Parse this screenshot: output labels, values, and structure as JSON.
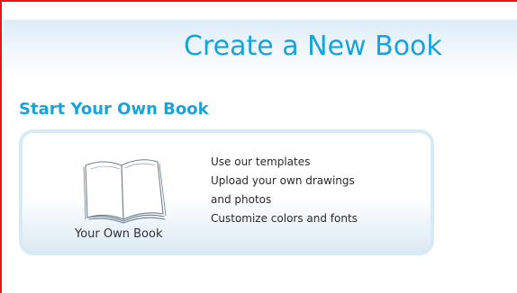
{
  "header": {
    "title": "Create a New Book"
  },
  "section": {
    "heading": "Start Your Own Book"
  },
  "card": {
    "label": "Your Own Book",
    "icon": "open-book-icon",
    "features": [
      "Use our templates",
      "Upload your own drawings",
      "and photos",
      "Customize colors and fonts"
    ]
  },
  "colors": {
    "accent": "#17a3dc",
    "frame_border": "#e8141b",
    "card_border": "#d8eaf5"
  }
}
